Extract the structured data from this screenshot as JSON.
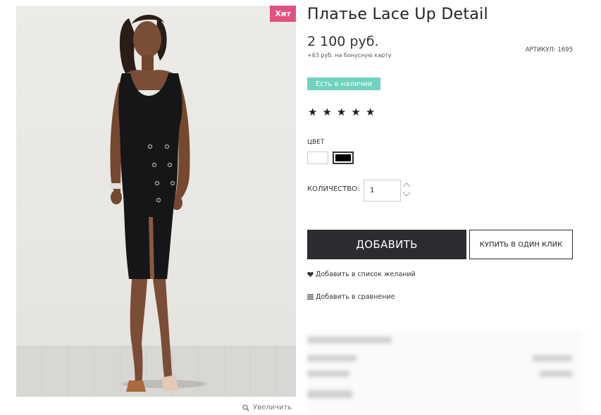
{
  "product": {
    "title": "Платье Lace Up Detail",
    "price": "2 100 руб.",
    "bonus": "+63 руб. на бонусную карту",
    "sku": "АРТИКУЛ: 1695",
    "stock": "Есть в наличии",
    "badge": "Хит",
    "rating": 5,
    "color_label": "ЦВЕТ",
    "colors": [
      "white",
      "black"
    ],
    "selected_color": "black",
    "quantity_label": "КОЛИЧЕСТВО:",
    "quantity": "1",
    "add_button": "ДОБАВИТЬ",
    "one_click_button": "КУПИТЬ В ОДИН КЛИК",
    "wishlist_link": "Добавить в список желаний",
    "compare_link": "Добавить в сравнение",
    "zoom_link": "Увеличить"
  },
  "colors_ui": {
    "badge_pink": "#e2517d",
    "stock_green": "#6fd3be",
    "button_dark": "#2a2c2f"
  },
  "icons": {
    "zoom": "search-icon",
    "wishlist": "heart-icon",
    "compare": "list-icon",
    "star": "star-icon"
  }
}
